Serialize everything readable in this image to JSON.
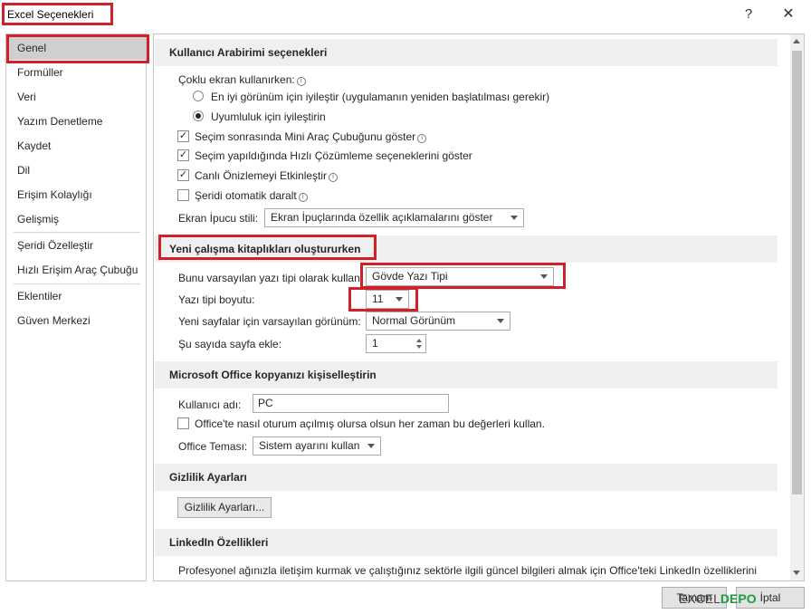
{
  "window": {
    "title": "Excel Seçenekleri",
    "help_label": "?",
    "close_label": "✕"
  },
  "sidebar": {
    "items": [
      {
        "label": "Genel"
      },
      {
        "label": "Formüller"
      },
      {
        "label": "Veri"
      },
      {
        "label": "Yazım Denetleme"
      },
      {
        "label": "Kaydet"
      },
      {
        "label": "Dil"
      },
      {
        "label": "Erişim Kolaylığı"
      },
      {
        "label": "Gelişmiş"
      },
      {
        "label": "Şeridi Özelleştir"
      },
      {
        "label": "Hızlı Erişim Araç Çubuğu"
      },
      {
        "label": "Eklentiler"
      },
      {
        "label": "Güven Merkezi"
      }
    ],
    "active": "Genel"
  },
  "ui_section": {
    "title": "Kullanıcı Arabirimi seçenekleri",
    "multi_screen_label": "Çoklu ekran kullanırken:",
    "radio_best": "En iyi görünüm için iyileştir (uygulamanın yeniden başlatılması gerekir)",
    "radio_compat": "Uyumluluk için iyileştirin",
    "radio_selected": "compat",
    "cb_mini_toolbar": "Seçim sonrasında Mini Araç Çubuğunu göster",
    "cb_quick_analysis": "Seçim yapıldığında Hızlı Çözümleme seçeneklerini göster",
    "cb_live_preview": "Canlı Önizlemeyi Etkinleştir",
    "cb_collapse_ribbon": "Şeridi otomatik daralt",
    "screentip_label": "Ekran İpucu stili:",
    "screentip_value": "Ekran İpuçlarında özellik açıklamalarını göster"
  },
  "new_workbook": {
    "title": "Yeni çalışma kitaplıkları oluştururken",
    "default_font_label": "Bunu varsayılan yazı tipi olarak kullan:",
    "default_font_value": "Gövde Yazı Tipi",
    "font_size_label": "Yazı tipi boyutu:",
    "font_size_value": "11",
    "default_view_label": "Yeni sayfalar için varsayılan görünüm:",
    "default_view_value": "Normal Görünüm",
    "sheets_count_label": "Şu sayıda sayfa ekle:",
    "sheets_count_value": "1"
  },
  "personalize": {
    "title": "Microsoft Office kopyanızı kişiselleştirin",
    "username_label": "Kullanıcı adı:",
    "username_value": "PC",
    "always_use_label": "Office'te nasıl oturum açılmış olursa olsun her zaman bu değerleri kullan.",
    "theme_label": "Office Teması:",
    "theme_value": "Sistem ayarını kullan"
  },
  "privacy": {
    "title": "Gizlilik Ayarları",
    "button_label": "Gizlilik Ayarları..."
  },
  "linkedin": {
    "title": "LinkedIn Özellikleri",
    "description": "Profesyonel ağınızla iletişim kurmak ve çalıştığınız sektörle ilgili güncel bilgileri almak için Office'teki LinkedIn özelliklerini kullanın."
  },
  "footer": {
    "ok_label": "Tamam",
    "cancel_label": "İptal",
    "watermark_a": "EXCEL",
    "watermark_b": "DEPO"
  }
}
